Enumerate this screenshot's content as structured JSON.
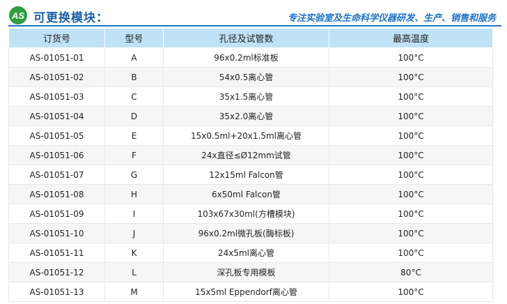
{
  "header": {
    "logo_icon": "as-logo-icon",
    "title": "可更换模块：",
    "slogan": "专注实验室及生命科学仪器研发、生产、销售和服务",
    "accent_color": "#1a73c8",
    "logo_color": "#2e9e3f"
  },
  "table": {
    "columns": [
      "订货号",
      "型号",
      "孔径及试管数",
      "最高温度"
    ],
    "rows": [
      {
        "order_no": "AS-01051-01",
        "model": "A",
        "spec": "96x0.2ml标准板",
        "max_temp": "100°C"
      },
      {
        "order_no": "AS-01051-02",
        "model": "B",
        "spec": "54x0.5离心管",
        "max_temp": "100°C"
      },
      {
        "order_no": "AS-01051-03",
        "model": "C",
        "spec": "35x1.5离心管",
        "max_temp": "100°C"
      },
      {
        "order_no": "AS-01051-04",
        "model": "D",
        "spec": "35x2.0离心管",
        "max_temp": "100°C"
      },
      {
        "order_no": "AS-01051-05",
        "model": "E",
        "spec": "15x0.5ml+20x1.5ml离心管",
        "max_temp": "100°C"
      },
      {
        "order_no": "AS-01051-06",
        "model": "F",
        "spec": "24x直径≤Ø12mm试管",
        "max_temp": "100°C"
      },
      {
        "order_no": "AS-01051-07",
        "model": "G",
        "spec": "12x15ml Falcon管",
        "max_temp": "100°C"
      },
      {
        "order_no": "AS-01051-08",
        "model": "H",
        "spec": "6x50ml Falcon管",
        "max_temp": "100°C"
      },
      {
        "order_no": "AS-01051-09",
        "model": "I",
        "spec": "103x67x30ml(方槽模块)",
        "max_temp": "100°C"
      },
      {
        "order_no": "AS-01051-10",
        "model": "J",
        "spec": "96x0.2ml微孔板(酶标板)",
        "max_temp": "100°C"
      },
      {
        "order_no": "AS-01051-11",
        "model": "K",
        "spec": "24x5ml离心管",
        "max_temp": "100°C"
      },
      {
        "order_no": "AS-01051-12",
        "model": "L",
        "spec": "深孔板专用模板",
        "max_temp": "80°C"
      },
      {
        "order_no": "AS-01051-13",
        "model": "M",
        "spec": "15x5ml Eppendorf离心管",
        "max_temp": "100°C"
      }
    ]
  }
}
